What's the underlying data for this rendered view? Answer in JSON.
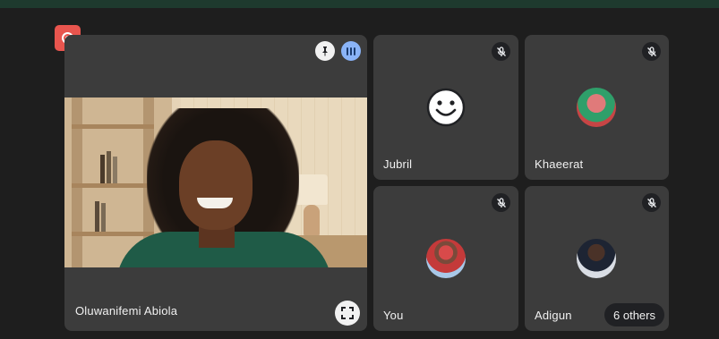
{
  "recording": {
    "icon": "record-icon",
    "color": "#e8554e"
  },
  "main_participant": {
    "name": "Oluwanifemi Abiola",
    "pin_icon": "pin-icon",
    "speaking_icon": "audio-level-icon",
    "fullscreen_icon": "fullscreen-icon"
  },
  "participants": [
    {
      "name": "Jubril",
      "avatar": "smiley-avatar",
      "muted": true
    },
    {
      "name": "Khaeerat",
      "avatar": "photo-avatar",
      "muted": true
    },
    {
      "name": "You",
      "avatar": "photo-avatar",
      "muted": true
    },
    {
      "name": "Adigun",
      "avatar": "photo-avatar",
      "muted": true
    }
  ],
  "others": {
    "label": "6 others"
  },
  "colors": {
    "tile_bg": "#3c3c3c",
    "page_bg": "#1e1e1e",
    "top_border": "#1e3a2e",
    "speaking": "#8ab4f8"
  }
}
